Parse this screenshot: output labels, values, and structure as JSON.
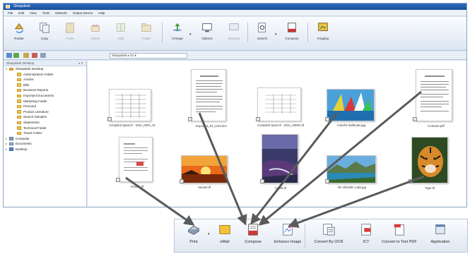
{
  "window": {
    "title": "Sharpdesk"
  },
  "menu": [
    "File",
    "Edit",
    "View",
    "Tools",
    "Network",
    "Output Device",
    "Help"
  ],
  "toolbar": {
    "buttons": [
      {
        "label": "Rotate",
        "icon": "rotate-icon"
      },
      {
        "label": "Copy",
        "icon": "copy-icon"
      },
      {
        "label": "Paste",
        "icon": "paste-icon"
      },
      {
        "label": "Delete",
        "icon": "delete-icon"
      },
      {
        "label": "Split",
        "icon": "split-icon"
      },
      {
        "label": "Folder",
        "icon": "folder-icon"
      },
      {
        "label": "Arrange",
        "icon": "arrange-icon"
      },
      {
        "label": "Options",
        "icon": "options-icon"
      },
      {
        "label": "Desktop",
        "icon": "desktop-icon"
      },
      {
        "label": "Search",
        "icon": "search-icon"
      },
      {
        "label": "Compose",
        "icon": "compose-icon"
      },
      {
        "label": "Imaging",
        "icon": "imaging-icon"
      }
    ]
  },
  "address": {
    "value": "Sharpdesk ▸ 01 ▾"
  },
  "sidebar": {
    "title": "Sharpdesk Desktop",
    "items": [
      {
        "label": "Sharpdesk Desktop",
        "level": 0,
        "type": "root"
      },
      {
        "label": "Administration Folder",
        "level": 1
      },
      {
        "label": "Articles",
        "level": 1
      },
      {
        "label": "Bills",
        "level": 1
      },
      {
        "label": "Business Reports",
        "level": 1
      },
      {
        "label": "Important Documents",
        "level": 1
      },
      {
        "label": "Marketing Folder",
        "level": 1
      },
      {
        "label": "Personal",
        "level": 1
      },
      {
        "label": "Product Literature",
        "level": 1
      },
      {
        "label": "Search Samples",
        "level": 1
      },
      {
        "label": "Statements",
        "level": 1
      },
      {
        "label": "Technical Folder",
        "level": 1
      },
      {
        "label": "Travel Folder",
        "level": 1
      },
      {
        "label": "Computer",
        "level": 0,
        "type": "comp"
      },
      {
        "label": "Documents",
        "level": 0,
        "type": "docs"
      },
      {
        "label": "Desktop",
        "level": 0,
        "type": "desk"
      }
    ]
  },
  "thumbnails": [
    {
      "caption": "Compiled Speech - 2011_0001_01",
      "kind": "table-doc"
    },
    {
      "caption": "Exported_01_Lists.doc",
      "kind": "text-doc"
    },
    {
      "caption": "Compiled Speech - 2011_00001.tif",
      "kind": "table-doc2"
    },
    {
      "caption": "Colorful Sailboats.jpg",
      "kind": "photo-sail"
    },
    {
      "caption": "Contract.pdf",
      "kind": "text-doc"
    },
    {
      "caption": "Invoice.tif",
      "kind": "form-doc"
    },
    {
      "caption": "Sunset.tif",
      "kind": "photo-sunset"
    },
    {
      "caption": "Coast.tif",
      "kind": "photo-coast"
    },
    {
      "caption": "Mt. Whistler Lake.jpg",
      "kind": "photo-lake"
    },
    {
      "caption": "Tiger.tif",
      "kind": "photo-tiger"
    }
  ],
  "bottom_toolbar": {
    "buttons": [
      {
        "label": "Print",
        "icon": "print-icon"
      },
      {
        "label": "eMail",
        "icon": "email-icon"
      },
      {
        "label": "Compose",
        "icon": "compose-icon"
      },
      {
        "label": "Enhance Image",
        "icon": "enhance-image-icon"
      },
      {
        "label": "Convert By OCR",
        "icon": "ocr-icon"
      },
      {
        "label": "ICT",
        "icon": "ict-icon"
      },
      {
        "label": "Convert to Text PDF",
        "icon": "convert-pdf-icon"
      },
      {
        "label": "Application",
        "icon": "application-icon"
      }
    ]
  },
  "colors": {
    "arrow": "#5a5a5a",
    "titlebar": "#1f5aa8",
    "panel": "#dfe8f3"
  }
}
